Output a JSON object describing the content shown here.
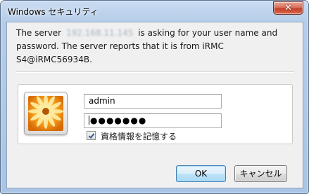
{
  "window": {
    "title": "Windows セキュリティ",
    "close_glyph": "✕"
  },
  "message": {
    "line1_before": "The server",
    "server_ip": "192.168.11.145",
    "line1_after": "is asking for your user name and password. The server reports that it is from iRMC S4@iRMC56934B."
  },
  "credentials": {
    "username": "admin",
    "password_masked": "●●●●●●●",
    "remember_label": "資格情報を記憶する",
    "remember_checked": true
  },
  "buttons": {
    "ok": "OK",
    "cancel": "キャンセル"
  },
  "colors": {
    "accent": "#3c7fb1",
    "close_red": "#c4402a",
    "frame": "#a9c4e4"
  },
  "icons": {
    "user_tile": "user-tile-icon",
    "close": "close-icon",
    "check": "check-icon"
  }
}
